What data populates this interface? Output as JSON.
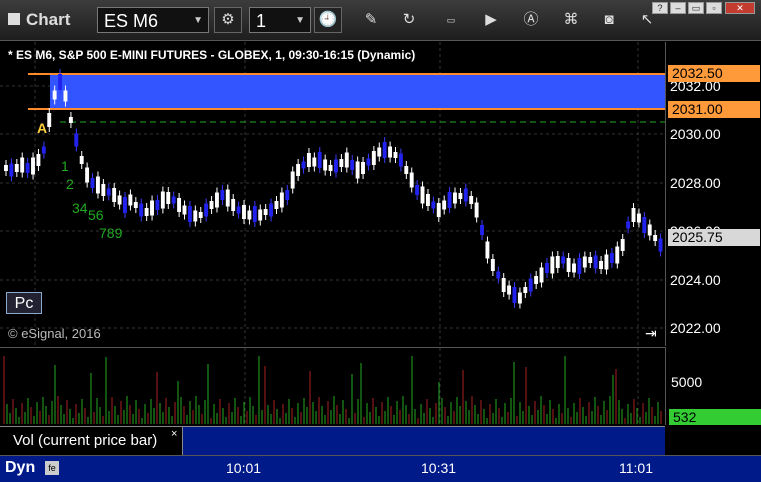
{
  "window": {
    "title": "Chart",
    "minimize": "?",
    "maximize": "▫",
    "close": "✕"
  },
  "toolbar": {
    "symbol": "ES M6",
    "interval": "1"
  },
  "chart": {
    "header": "* ES M6, S&P 500 E-MINI FUTURES - GLOBEX, 1, 09:30-16:15 (Dynamic)",
    "price_labels": [
      "2032.00",
      "2030.00",
      "2028.00",
      "2026.00",
      "2024.00",
      "2022.00"
    ],
    "range_high_tag": "2032.50",
    "range_low_tag": "2031.00",
    "last_price_tag": "2025.75",
    "marker_a": "A",
    "td_counts": [
      "1",
      "2",
      "34",
      "56",
      "789"
    ],
    "copyright": "© eSignal, 2016",
    "pc_button": "Pc",
    "colors": {
      "range_fill": "#3355ff",
      "range_border": "#ff8a2a",
      "up_bar": "#ffffff",
      "down_bar": "#2222ee",
      "green": "#22aa22"
    }
  },
  "volume": {
    "label": "Vol (current price bar)",
    "close": "×",
    "axis_label": "5000",
    "last_tag": "532"
  },
  "timebar": {
    "mode": "Dyn",
    "icon": "fe",
    "times": [
      "10:01",
      "10:31",
      "11:01"
    ]
  }
}
